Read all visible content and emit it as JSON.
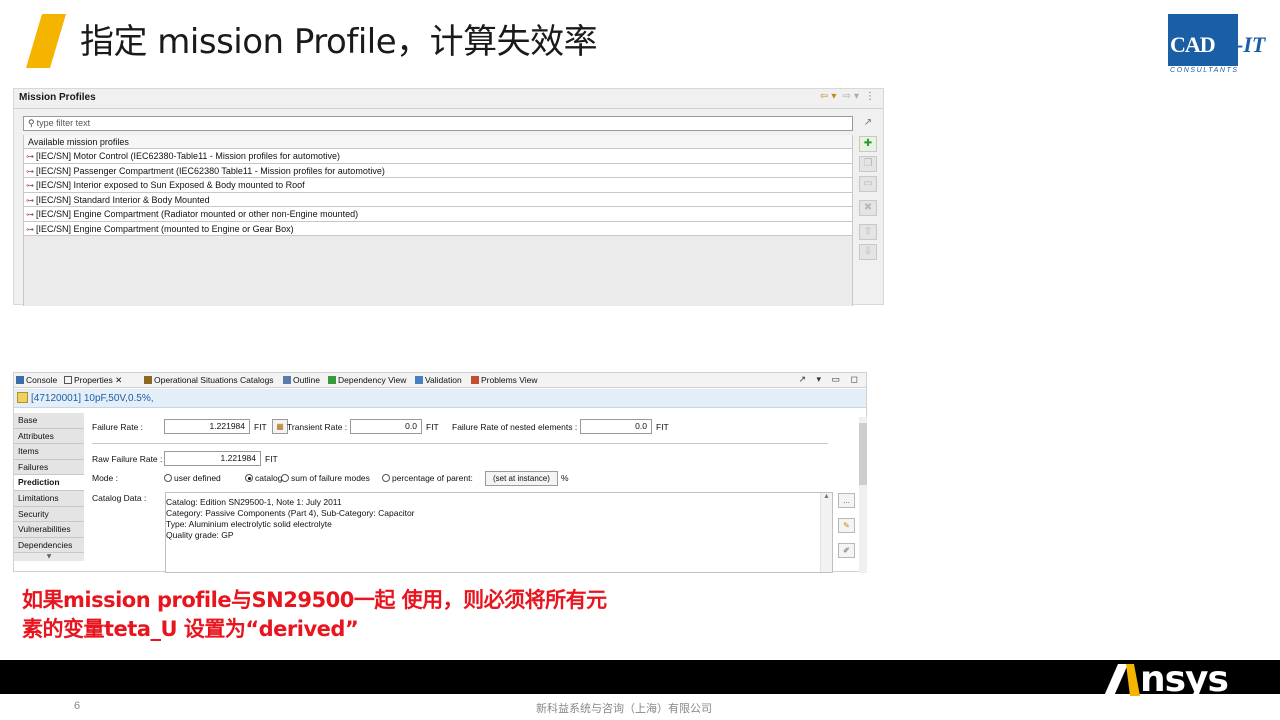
{
  "slide": {
    "title": "指定 mission Profile，计算失效率",
    "page_number": "6",
    "company_footer": "新科益系统与咨询（上海）有限公司",
    "accent_color": "#f5b400",
    "note_color": "#e8141e"
  },
  "logos": {
    "cad_it": {
      "main": "CAD",
      "suffix": "-IT",
      "sub": "CONSULTANTS",
      "color": "#1a5ea6"
    },
    "ansys": {
      "text": "nsys"
    }
  },
  "mission_profiles": {
    "panel_title": "Mission Profiles",
    "filter_placeholder": "type filter text",
    "list_header": "Available mission profiles",
    "items": [
      "[IEC/SN] Motor Control (IEC62380-Table11 - Mission profiles for automotive)",
      "[IEC/SN] Passenger Compartment (IEC62380 Table11 - Mission profiles for automotive)",
      "[IEC/SN] Interior exposed to Sun Exposed & Body mounted to Roof",
      "[IEC/SN] Standard Interior & Body Mounted",
      "[IEC/SN] Engine Compartment (Radiator mounted or other non-Engine mounted)",
      "[IEC/SN] Engine Compartment (mounted to Engine or Gear Box)"
    ],
    "side_buttons": [
      "add-icon",
      "duplicate-icon",
      "edit-icon",
      "delete-icon",
      "move-up-icon",
      "move-down-icon"
    ]
  },
  "properties": {
    "tabs": [
      "Console",
      "Properties",
      "Operational Situations Catalogs",
      "Outline",
      "Dependency View",
      "Validation",
      "Problems View"
    ],
    "selected_element": "[47120001] 10pF,50V,0.5%,",
    "side_tabs": [
      "Base",
      "Attributes",
      "Items",
      "Failures",
      "Prediction",
      "Limitations",
      "Security",
      "Vulnerabilities",
      "Dependencies"
    ],
    "selected_side_tab": "Prediction",
    "failure_rate_label": "Failure Rate :",
    "failure_rate_value": "1.221984",
    "transient_rate_label": "Transient Rate :",
    "transient_rate_value": "0.0",
    "nested_label": "Failure Rate of nested elements :",
    "nested_value": "0.0",
    "unit": "FIT",
    "raw_failure_label": "Raw Failure Rate :",
    "raw_failure_value": "1.221984",
    "mode_label": "Mode :",
    "mode_options": [
      "user defined",
      "catalog",
      "sum of failure modes",
      "percentage of parent:"
    ],
    "mode_selected": "catalog",
    "set_at_instance": "(set at instance)",
    "percent": "%",
    "catalog_label": "Catalog Data :",
    "catalog_lines": [
      "Catalog: Edition SN29500-1, Note 1: July 2011",
      "Category: Passive Components (Part 4), Sub-Category: Capacitor",
      "Type: Aluminium electrolytic solid electrolyte",
      "Quality grade: GP"
    ],
    "catalog_buttons": [
      "...",
      "wand-icon",
      "edit-icon"
    ]
  },
  "note": {
    "line1": "如果mission profile与SN29500一起 使用，则必须将所有元",
    "line2": "素的变量teta_U 设置为“derived”"
  }
}
